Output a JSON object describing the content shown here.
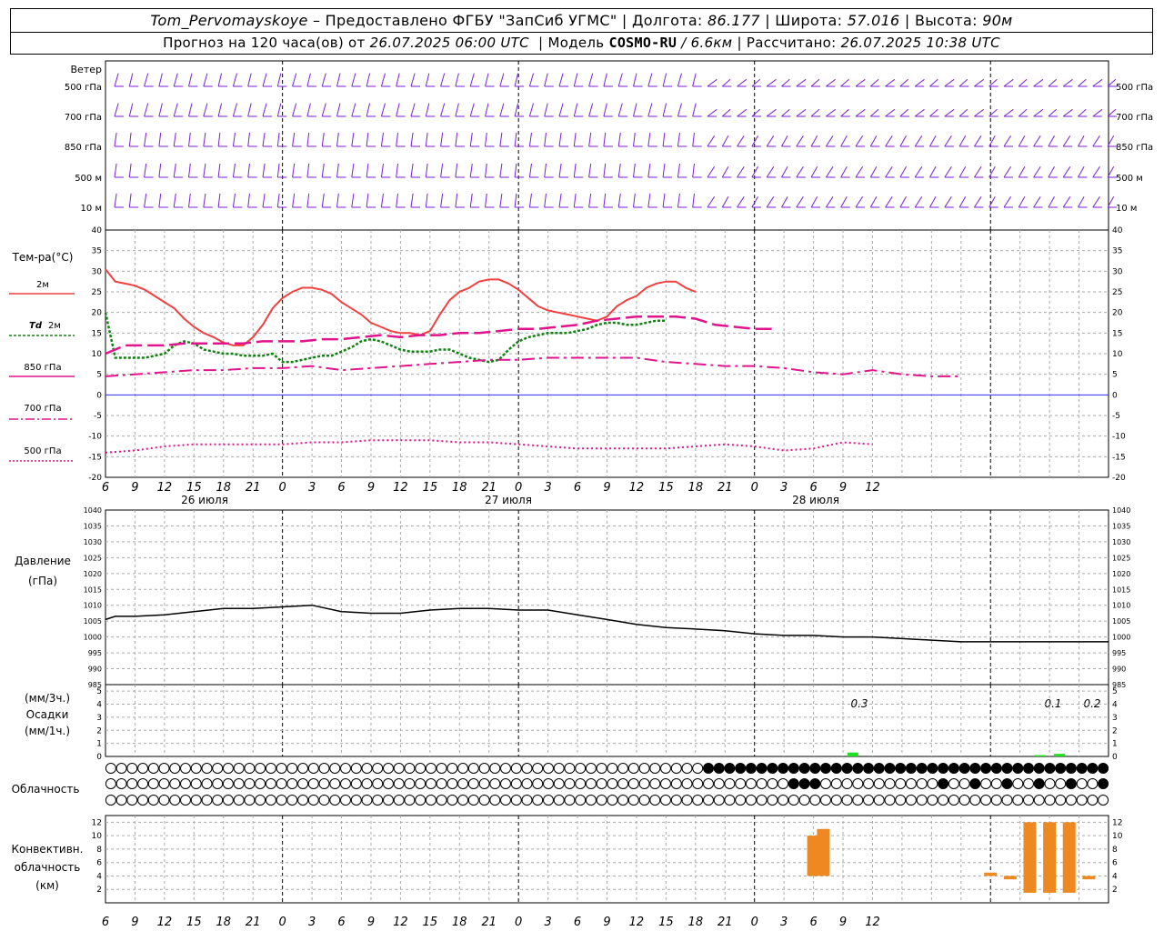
{
  "header": {
    "station": "Tom_Pervomayskoye",
    "provider": "– Предоставлено ФГБУ \"ЗапСиб УГМС\"",
    "lon_label": "Долгота:",
    "lon_value": "86.177",
    "lat_label": "Широта:",
    "lat_value": "57.016",
    "alt_label": "Высота:",
    "alt_value": "90м",
    "forecast_label": "Прогноз на 120 часа(ов) от",
    "forecast_start": "26.07.2025 06:00 UTC",
    "model_label": "Модель",
    "model_name": "COSMO-RU",
    "model_res": "/ 6.6км",
    "calc_label": "Рассчитано:",
    "calc_time": "26.07.2025 10:38 UTC"
  },
  "labels": {
    "wind": "Ветер",
    "wind_levels": [
      "500 гПа",
      "700 гПа",
      "850 гПа",
      "500 м",
      "10  м"
    ],
    "temp_title": "Тем-ра(°C)",
    "t2m": "2м",
    "td_prefix": "Td",
    "td_suffix": "2м",
    "t850": "850 гПа",
    "t700": "700 гПа",
    "t500": "500 гПа",
    "pressure_1": "Давление",
    "pressure_2": "(гПа)",
    "precip_1": "(мм/3ч.)",
    "precip_2": "Осадки",
    "precip_3": "(мм/1ч.)",
    "cloud": "Облачность",
    "conv_1": "Конвективн.",
    "conv_2": "облачность",
    "conv_3": "(км)",
    "days": [
      "26 июля",
      "27 июля",
      "28 июля"
    ],
    "precip_annotations": [
      "0.3",
      "0.1",
      "0.2"
    ]
  },
  "colors": {
    "wind": "#7b1fd6",
    "t2m": "#f04040",
    "td": "#108010",
    "t850": "#e0148c",
    "zero": "#3030ff",
    "precip": "#22dd22",
    "convective": "#ee8820"
  },
  "chart_data": {
    "type": "line",
    "x_unit": "hours since 26.07.2025 00 UTC",
    "x_range_hours": [
      6,
      108
    ],
    "x_tick_labels": [
      "6",
      "9",
      "12",
      "15",
      "18",
      "21",
      "0",
      "3",
      "6",
      "9",
      "12",
      "15",
      "18",
      "21",
      "0",
      "3",
      "6",
      "9",
      "12",
      "15",
      "18",
      "21",
      "0",
      "3",
      "6",
      "9",
      "12"
    ],
    "temperature": {
      "ylim": [
        -20,
        40
      ],
      "yticks": [
        40,
        35,
        30,
        25,
        20,
        15,
        10,
        5,
        0,
        -5,
        -10,
        -15,
        -20
      ],
      "series": [
        {
          "name": "2м",
          "values": [
            30.5,
            27.5,
            27,
            26.5,
            25.5,
            24,
            21,
            18.5,
            16.5,
            15,
            14,
            12.7,
            12,
            12,
            14,
            17,
            21,
            23.5,
            25,
            26,
            26,
            25.5,
            24.5,
            22.5,
            19.5,
            17.5,
            16.5,
            15.5,
            15,
            15,
            14.5,
            15.5,
            19.5,
            23,
            25,
            26,
            27.5,
            28,
            28,
            27,
            25.5,
            23.5,
            21.5,
            20.5,
            20,
            19.5,
            19,
            18.5,
            18,
            19,
            21.5,
            23,
            24,
            26,
            27,
            27.5,
            27.5,
            26,
            25
          ],
          "x": [
            6,
            7,
            8,
            9,
            10,
            11,
            13,
            14,
            15,
            16,
            17,
            18,
            19,
            20,
            21,
            22,
            23,
            24,
            25,
            26,
            27,
            28,
            29,
            30,
            32,
            33,
            34,
            35,
            36,
            37,
            38,
            39,
            40,
            41,
            42,
            43,
            44,
            45,
            46,
            47,
            48,
            49,
            50,
            51,
            52,
            53,
            54,
            55,
            56,
            57,
            58,
            59,
            60,
            61,
            62,
            63,
            64,
            65,
            66
          ]
        },
        {
          "name": "Td 2м",
          "values": [
            20,
            9,
            9,
            9.5,
            10,
            12,
            13,
            12.5,
            11,
            10.5,
            10,
            10,
            9.5,
            9.5,
            9.5,
            10,
            8,
            8,
            8.5,
            9,
            9.5,
            9.5,
            10.5,
            11.5,
            13,
            13.5,
            13,
            12,
            11,
            10.5,
            10.5,
            10.5,
            11,
            11,
            10,
            9,
            8.5,
            8,
            8.5,
            11,
            13,
            14,
            14.5,
            15,
            15,
            15,
            15.5,
            16,
            17,
            17.5,
            17.5,
            17,
            17,
            17.5,
            18,
            18
          ],
          "x": [
            6,
            7,
            10,
            11,
            12,
            13,
            14,
            15,
            16,
            17,
            18,
            19,
            20,
            21,
            22,
            23,
            24,
            25,
            26,
            27,
            28,
            29,
            30,
            31,
            32,
            33,
            34,
            35,
            36,
            37,
            38,
            39,
            40,
            41,
            42,
            43,
            44,
            45,
            46,
            47,
            48,
            49,
            50,
            51,
            52,
            53,
            54,
            55,
            56,
            57,
            58,
            59,
            60,
            61,
            62,
            63
          ]
        },
        {
          "name": "850 гПа",
          "values": [
            10,
            12,
            12,
            12,
            12.5,
            12.5,
            12.5,
            12.5,
            13,
            13,
            13,
            13.5,
            13.5,
            14,
            14.5,
            14,
            14.5,
            14.5,
            15,
            15,
            15.5,
            16,
            16,
            16.5,
            17,
            18,
            18.5,
            19,
            19,
            19,
            18.5,
            17,
            16.5,
            16,
            16
          ],
          "x": [
            6,
            8,
            10,
            12,
            14,
            16,
            18,
            20,
            22,
            24,
            26,
            28,
            30,
            32,
            34,
            36,
            38,
            40,
            42,
            44,
            46,
            48,
            50,
            52,
            54,
            56,
            58,
            60,
            62,
            64,
            66,
            68,
            70,
            72,
            74
          ]
        },
        {
          "name": "700 гПа",
          "values": [
            4.5,
            5,
            5.5,
            6,
            6,
            6.5,
            6.5,
            7,
            6,
            6.5,
            7,
            7.5,
            8,
            8.5,
            8.5,
            9,
            9,
            9,
            9,
            8,
            7.5,
            7,
            7,
            6.5,
            5.5,
            5,
            6,
            5,
            4.5,
            4.5
          ],
          "x": [
            6,
            9,
            12,
            15,
            18,
            21,
            24,
            27,
            30,
            33,
            36,
            39,
            42,
            45,
            48,
            51,
            54,
            57,
            60,
            63,
            66,
            69,
            72,
            75,
            78,
            81,
            84,
            87,
            90,
            93
          ]
        },
        {
          "name": "500 гПа",
          "values": [
            -14,
            -13.5,
            -12.5,
            -12,
            -12,
            -12,
            -12,
            -11.5,
            -11.5,
            -11,
            -11,
            -11,
            -11.5,
            -11.5,
            -12,
            -12.5,
            -13,
            -13,
            -13,
            -13,
            -12.5,
            -12,
            -12.5,
            -13.5,
            -13,
            -11.5,
            -12
          ],
          "x": [
            6,
            9,
            12,
            15,
            18,
            21,
            24,
            27,
            30,
            33,
            36,
            39,
            42,
            45,
            48,
            51,
            54,
            57,
            60,
            63,
            66,
            69,
            72,
            75,
            78,
            81,
            84
          ]
        }
      ]
    },
    "pressure": {
      "ylim": [
        985,
        1040
      ],
      "yticks": [
        1040,
        1035,
        1030,
        1025,
        1020,
        1015,
        1010,
        1005,
        1000,
        995,
        990,
        985
      ],
      "x": [
        6,
        7,
        9,
        12,
        15,
        18,
        21,
        24,
        27,
        30,
        33,
        36,
        39,
        42,
        45,
        48,
        51,
        54,
        57,
        60,
        63,
        66,
        69,
        72,
        75,
        78,
        81,
        84,
        87,
        90,
        93,
        96,
        99,
        102,
        105,
        108
      ],
      "values": [
        1005.5,
        1006.5,
        1006.5,
        1007,
        1008,
        1009,
        1009,
        1009.5,
        1010,
        1008,
        1007.5,
        1007.5,
        1008.5,
        1009,
        1009,
        1008.5,
        1008.5,
        1007,
        1005.5,
        1004,
        1003,
        1002.5,
        1002,
        1001,
        1000.5,
        1000.5,
        1000,
        1000,
        999.5,
        999,
        998.5,
        998.5,
        998.5,
        998.5,
        998.5,
        998.5
      ]
    },
    "precipitation": {
      "ylim": [
        0,
        5
      ],
      "bars": [
        {
          "x": 82,
          "value": 0.3
        },
        {
          "x": 101,
          "value": 0.1
        },
        {
          "x": 103,
          "value": 0.2
        }
      ]
    },
    "convective_cloud": {
      "ylim": [
        0,
        13
      ],
      "bars": [
        {
          "x": 78,
          "bottom": 4,
          "top": 10
        },
        {
          "x": 79,
          "bottom": 4,
          "top": 11
        },
        {
          "x": 96,
          "bottom": 4,
          "top": 4.5
        },
        {
          "x": 98,
          "bottom": 3.5,
          "top": 4
        },
        {
          "x": 100,
          "bottom": 1.5,
          "top": 12
        },
        {
          "x": 102,
          "bottom": 1.5,
          "top": 12
        },
        {
          "x": 104,
          "bottom": 1.5,
          "top": 12
        },
        {
          "x": 106,
          "bottom": 3.5,
          "top": 4
        }
      ]
    }
  }
}
